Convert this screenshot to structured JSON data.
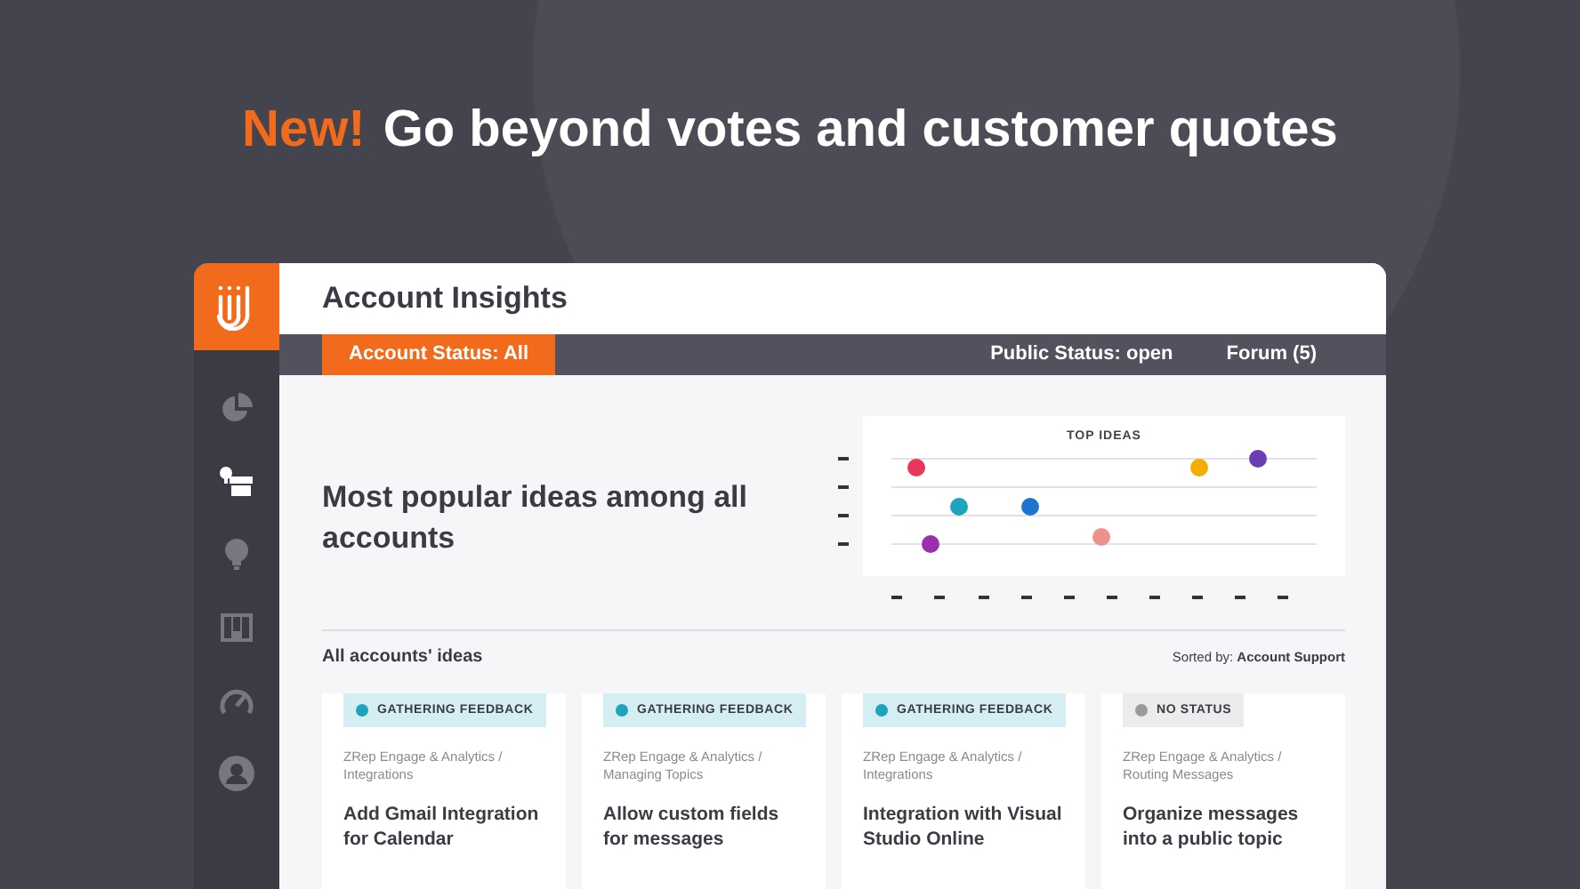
{
  "headline": {
    "badge": "New!",
    "title": "Go beyond votes and customer quotes"
  },
  "sidebar": {
    "items": [
      {
        "kind": "pie",
        "selected": false
      },
      {
        "kind": "store",
        "selected": true
      },
      {
        "kind": "bulb",
        "selected": false
      },
      {
        "kind": "board",
        "selected": false
      },
      {
        "kind": "gauge",
        "selected": false
      },
      {
        "kind": "user",
        "selected": false
      }
    ]
  },
  "header": {
    "title": "Account Insights"
  },
  "filters": [
    {
      "label": "Account Status: All",
      "selected": true
    },
    {
      "label": "Public Status: open",
      "selected": false
    },
    {
      "label": "Forum (5)",
      "selected": false
    }
  ],
  "summary": {
    "heading": "Most popular ideas among all accounts",
    "chart": {
      "title": "TOP IDEAS"
    }
  },
  "ideas": {
    "heading": "All accounts' ideas",
    "sort_label": "Sorted by:",
    "sort_value": "Account Support",
    "cards": [
      {
        "status": "GATHERING FEEDBACK",
        "color": "#1fa3bd",
        "category": "ZRep Engage & Analytics / Integrations",
        "title": "Add Gmail Integration for Calendar"
      },
      {
        "status": "GATHERING FEEDBACK",
        "color": "#1fa3bd",
        "category": "ZRep Engage & Analytics / Managing Topics",
        "title": "Allow custom fields for messages"
      },
      {
        "status": "GATHERING FEEDBACK",
        "color": "#1fa3bd",
        "category": "ZRep Engage & Analytics / Integrations",
        "title": "Integration with Visual Studio Online"
      },
      {
        "status": "NO STATUS",
        "color": "#9a9a9e",
        "category": "ZRep Engage & Analytics / Routing Messages",
        "title": "Organize messages into a public topic"
      }
    ]
  }
}
